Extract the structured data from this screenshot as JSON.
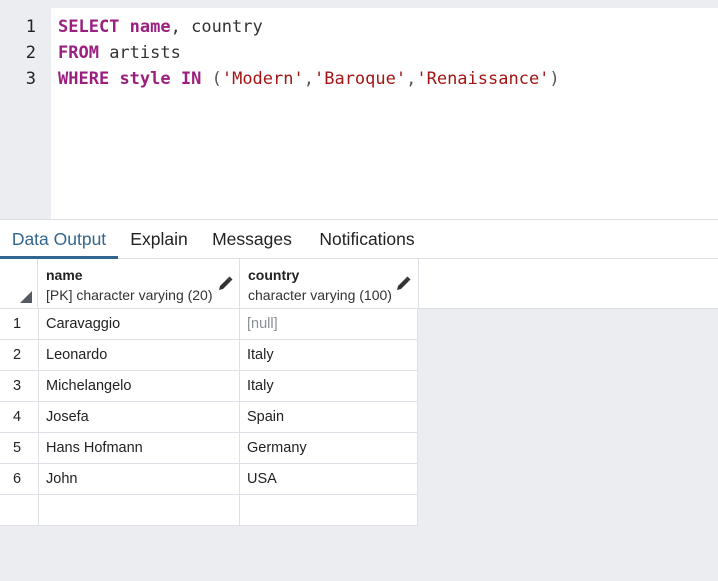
{
  "editor": {
    "line_numbers": [
      "1",
      "2",
      "3"
    ],
    "line1": {
      "kw1": "SELECT",
      "kw2": "name",
      "rest": ", country"
    },
    "line2": {
      "kw1": "FROM",
      "rest": " artists"
    },
    "line3": {
      "kw1": "WHERE",
      "kw2": "style",
      "kw3": "IN",
      "open": " (",
      "s1": "'Modern'",
      "comma1": ",",
      "s2": "'Baroque'",
      "comma2": ",",
      "s3": "'Renaissance'",
      "close": ")"
    }
  },
  "tabs": [
    {
      "label": "Data Output",
      "active": true
    },
    {
      "label": "Explain",
      "active": false
    },
    {
      "label": "Messages",
      "active": false
    },
    {
      "label": "Notifications",
      "active": false
    }
  ],
  "grid": {
    "columns": [
      {
        "name": "name",
        "type": "[PK] character varying (20)"
      },
      {
        "name": "country",
        "type": "character varying (100)"
      }
    ],
    "rows": [
      {
        "num": "1",
        "name": "Caravaggio",
        "country": "[null]"
      },
      {
        "num": "2",
        "name": "Leonardo",
        "country": "Italy"
      },
      {
        "num": "3",
        "name": "Michelangelo",
        "country": "Italy"
      },
      {
        "num": "4",
        "name": "Josefa",
        "country": "Spain"
      },
      {
        "num": "5",
        "name": "Hans Hofmann",
        "country": "Germany"
      },
      {
        "num": "6",
        "name": "John",
        "country": "USA"
      }
    ]
  },
  "icons": {
    "edit": "pencil-icon",
    "sort": "sort-triangle-icon"
  },
  "colors": {
    "keyword": "#9a1f7e",
    "string": "#a31515",
    "active_tab": "#326690",
    "null_text": "#8a8f98"
  }
}
